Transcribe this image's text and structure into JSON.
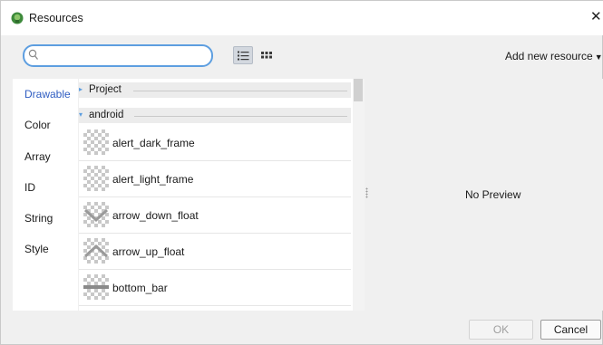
{
  "window": {
    "title": "Resources",
    "close_glyph": "✕",
    "app_icon": "android-studio-icon"
  },
  "toolbar": {
    "search": {
      "value": "",
      "placeholder": ""
    },
    "view_modes": [
      {
        "icon": "list-view-icon",
        "selected": true
      },
      {
        "icon": "grid-view-icon",
        "selected": false
      }
    ],
    "add_new_label": "Add new resource",
    "add_new_caret": "▼"
  },
  "categories": {
    "items": [
      {
        "label": "Drawable",
        "active": true
      },
      {
        "label": "Color",
        "active": false
      },
      {
        "label": "Array",
        "active": false
      },
      {
        "label": "ID",
        "active": false
      },
      {
        "label": "String",
        "active": false
      },
      {
        "label": "Style",
        "active": false
      }
    ]
  },
  "resource_list": {
    "groups": [
      {
        "label": "Project",
        "expanded": false,
        "arrow": "▸"
      },
      {
        "label": "android",
        "expanded": true,
        "arrow": "▾"
      }
    ],
    "items": [
      {
        "name": "alert_dark_frame",
        "icon": "frame-thumbnail"
      },
      {
        "name": "alert_light_frame",
        "icon": "frame-thumbnail"
      },
      {
        "name": "arrow_down_float",
        "icon": "arrow-down-thumbnail"
      },
      {
        "name": "arrow_up_float",
        "icon": "arrow-up-thumbnail"
      },
      {
        "name": "bottom_bar",
        "icon": "bar-thumbnail"
      }
    ]
  },
  "preview": {
    "empty_text": "No Preview"
  },
  "footer": {
    "ok_label": "OK",
    "ok_enabled": false,
    "cancel_label": "Cancel"
  },
  "colors": {
    "accent": "#2f5dc2",
    "focus": "#5d9ee0",
    "panel": "#f0f0f0"
  }
}
